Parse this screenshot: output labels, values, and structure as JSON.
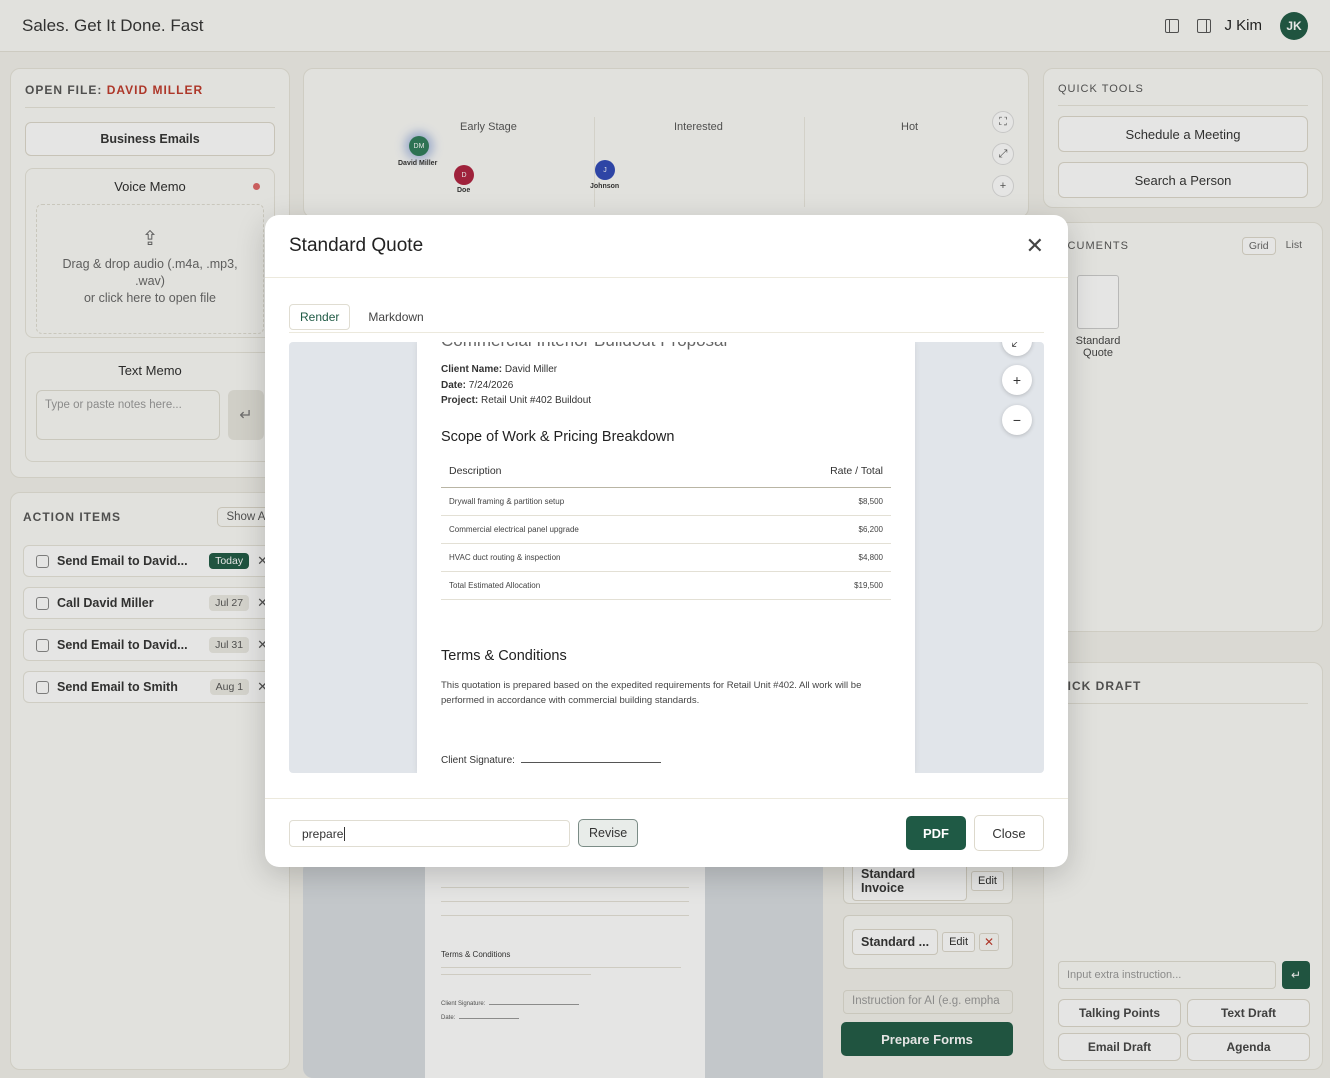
{
  "app": {
    "title": "Sales. Get It Done. Fast",
    "user_name": "J Kim",
    "user_initials": "JK"
  },
  "open_file": {
    "title_prefix": "OPEN FILE:",
    "client": "DAVID MILLER",
    "business_emails": "Business Emails",
    "voice_memo": {
      "title": "Voice Memo",
      "drop_line1": "Drag & drop audio (.m4a, .mp3,",
      "drop_line2": ".wav)",
      "drop_line3": "or click here to open file"
    },
    "text_memo": {
      "title": "Text Memo",
      "placeholder": "Type or paste notes here..."
    }
  },
  "action_items": {
    "title": "ACTION ITEMS",
    "show_all": "Show Al",
    "items": [
      {
        "label": "Send Email to David...",
        "badge": "Today"
      },
      {
        "label": "Call David Miller",
        "badge": "Jul 27"
      },
      {
        "label": "Send Email to David...",
        "badge": "Jul 31"
      },
      {
        "label": "Send Email to Smith",
        "badge": "Aug 1"
      }
    ]
  },
  "pipeline": {
    "stages": [
      "Early Stage",
      "Interested",
      "Hot"
    ],
    "contacts": [
      {
        "initials": "DM",
        "name": "David Miller"
      },
      {
        "initials": "D",
        "name": "Doe"
      },
      {
        "initials": "J",
        "name": "Johnson"
      }
    ]
  },
  "quick_tools": {
    "title": "QUICK TOOLS",
    "schedule": "Schedule a Meeting",
    "search": "Search a Person"
  },
  "documents": {
    "title": "OCUMENTS",
    "view_grid": "Grid",
    "view_list": "List",
    "item_line1": "Standard",
    "item_line2": "Quote"
  },
  "quick_draft": {
    "title": "UICK DRAFT",
    "placeholder": "Input extra instruction...",
    "buttons": [
      "Talking Points",
      "Text Draft",
      "Email Draft",
      "Agenda"
    ]
  },
  "forms": {
    "rows": [
      {
        "label": "Standard Invoice",
        "edit": "Edit"
      },
      {
        "label": "Standard ...",
        "edit": "Edit"
      }
    ],
    "ai_placeholder": "Instruction for AI (e.g. empha",
    "prepare": "Prepare Forms"
  },
  "bg_doc": {
    "terms_title": "Terms & Conditions",
    "sig": "Client Signature:",
    "date": "Date:"
  },
  "modal": {
    "title": "Standard Quote",
    "tab_render": "Render",
    "tab_markdown": "Markdown",
    "doc": {
      "clipped_title": "Commercial Interior Buildout Proposal",
      "client_label": "Client Name:",
      "client_value": "David Miller",
      "date_label": "Date:",
      "date_value": "7/24/2026",
      "project_label": "Project:",
      "project_value": "Retail Unit #402 Buildout",
      "scope_title": "Scope of Work & Pricing Breakdown",
      "col_desc": "Description",
      "col_rate": "Rate / Total",
      "rows": [
        {
          "desc": "Drywall framing & partition setup",
          "amount": "$8,500"
        },
        {
          "desc": "Commercial electrical panel upgrade",
          "amount": "$6,200"
        },
        {
          "desc": "HVAC duct routing & inspection",
          "amount": "$4,800"
        },
        {
          "desc": "Total Estimated Allocation",
          "amount": "$19,500"
        }
      ],
      "terms_title": "Terms & Conditions",
      "terms_text": "This quotation is prepared based on the expedited requirements for Retail Unit #402. All work will be performed in accordance with commercial building standards.",
      "signature_label": "Client Signature:"
    },
    "revise_value": "prepare",
    "revise_button": "Revise",
    "pdf_button": "PDF",
    "close_button": "Close"
  },
  "colors": {
    "accent": "#1f5a45",
    "danger": "#c0392b",
    "background": "#f3f2ec"
  }
}
